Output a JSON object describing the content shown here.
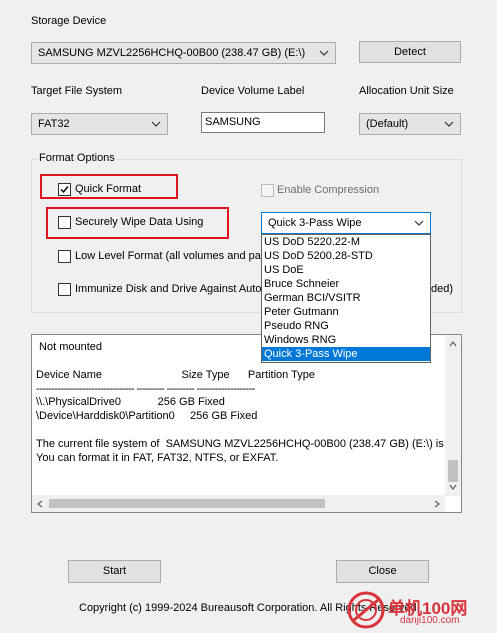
{
  "storage_device": {
    "label": "Storage Device",
    "selected": "SAMSUNG MZVL2256HCHQ-00B00 (238.47 GB) (E:\\)",
    "detect_label": "Detect"
  },
  "file_system": {
    "label": "Target File System",
    "selected": "FAT32"
  },
  "volume_label": {
    "label": "Device Volume Label",
    "value": "SAMSUNG"
  },
  "allocation": {
    "label": "Allocation Unit Size",
    "selected": "(Default)"
  },
  "format_options": {
    "title": "Format Options",
    "quick_format": {
      "label": "Quick Format",
      "checked": true
    },
    "enable_compression": {
      "label": "Enable Compression",
      "checked": false,
      "enabled": false
    },
    "secure_wipe": {
      "label": "Securely Wipe Data Using",
      "checked": false
    },
    "wipe_method": {
      "selected": "Quick 3-Pass Wipe",
      "options": [
        "US DoD 5220.22-M",
        "US DoD 5200.28-STD",
        "US DoE",
        "Bruce Schneier",
        "German BCI/VSITR",
        "Peter Gutmann",
        "Pseudo RNG",
        "Windows RNG",
        "Quick 3-Pass Wipe"
      ]
    },
    "low_level": {
      "label": "Low Level Format (all volumes and par",
      "checked": false
    },
    "immunize": {
      "label": "Immunize Disk and Drive Against Autoru",
      "tail": "ded)",
      "checked": false
    }
  },
  "info": {
    "lines": [
      " Not mounted",
      "",
      "Device Name                          Size Type      Partition Type",
      "-------------------------------- --------- --------- -------------------",
      "\\\\.\\PhysicalDrive0            256 GB Fixed",
      "\\Device\\Harddisk0\\Partition0     256 GB Fixed",
      "",
      "The current file system of  SAMSUNG MZVL2256HCHQ-00B00 (238.47 GB) (E:\\) is I",
      "You can format it in FAT, FAT32, NTFS, or EXFAT."
    ]
  },
  "buttons": {
    "start": "Start",
    "close": "Close"
  },
  "copyright": "Copyright (c) 1999-2024 Bureausoft Corporation. All Rights Reserved.",
  "watermark": {
    "text": "单机100网",
    "url": "danji100.com"
  },
  "colors": {
    "highlight": "#0078d7",
    "red_callout": "#e0141e",
    "watermark_red": "#d9333c"
  }
}
